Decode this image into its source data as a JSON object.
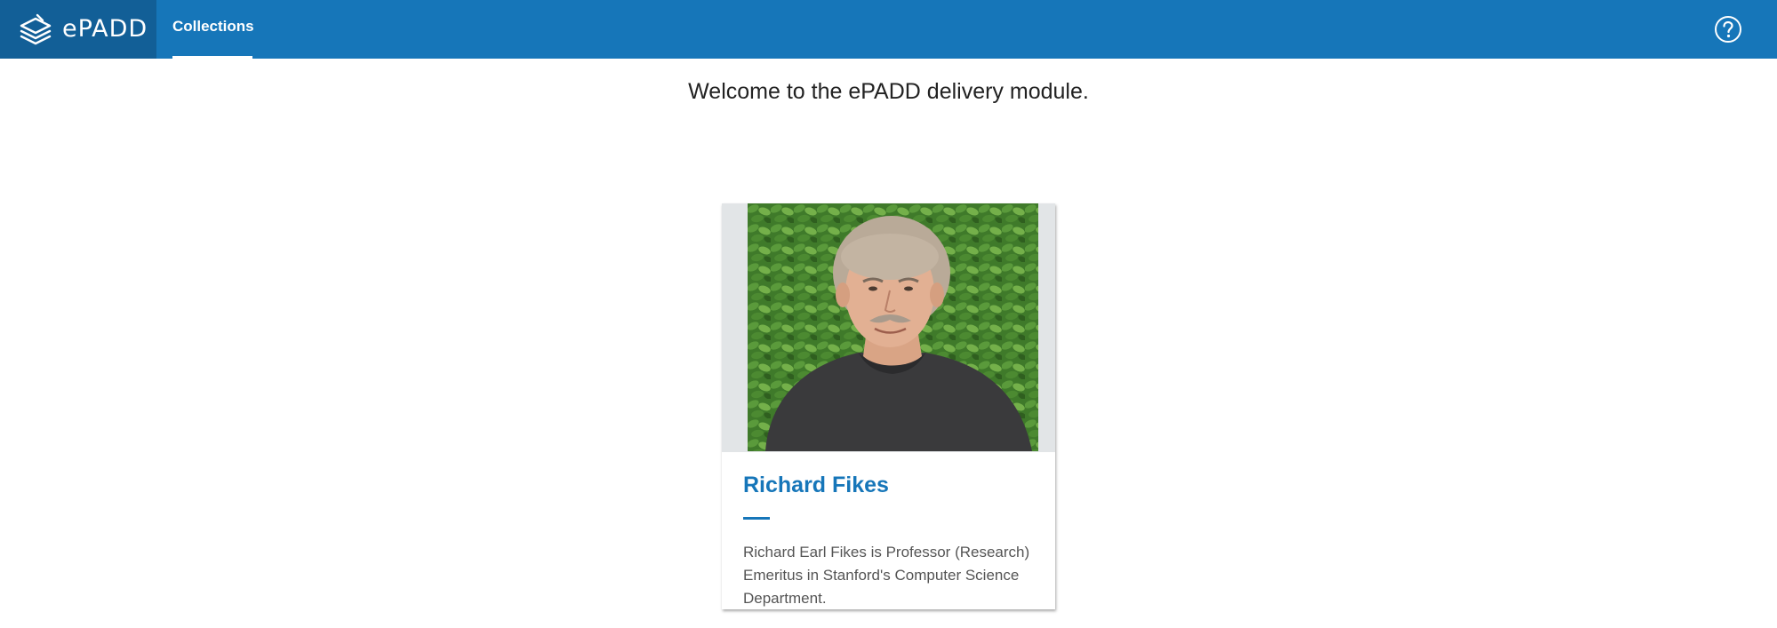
{
  "header": {
    "logo_text": "ePADD",
    "nav": [
      {
        "label": "Collections",
        "active": true
      }
    ],
    "help_icon": "question-circle-icon",
    "colors": {
      "bar": "#1676b9",
      "logo_bg": "#125f97"
    }
  },
  "main": {
    "welcome": "Welcome to the ePADD delivery module."
  },
  "collections": [
    {
      "name": "Richard Fikes",
      "description": "Richard Earl Fikes is Professor (Research) Emeritus in Stanford's Computer Science Department.",
      "photo": "portrait-photo"
    }
  ]
}
